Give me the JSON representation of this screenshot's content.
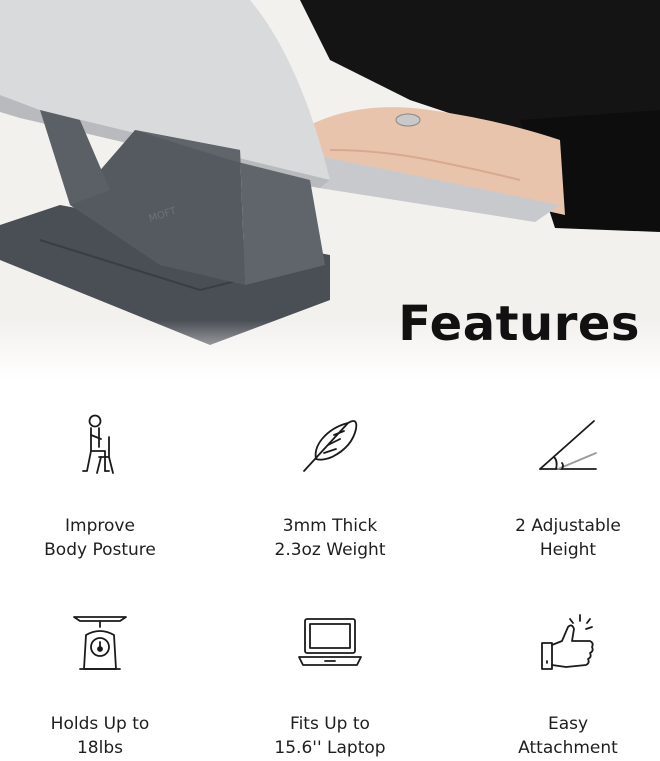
{
  "heading": "Features",
  "hero_brand_mark": "MOFT",
  "features": [
    {
      "icon": "sitting-person-icon",
      "line1": "Improve",
      "line2": "Body Posture"
    },
    {
      "icon": "feather-icon",
      "line1": "3mm Thick",
      "line2": "2.3oz Weight"
    },
    {
      "icon": "angle-icon",
      "line1": "2 Adjustable",
      "line2": "Height"
    },
    {
      "icon": "scale-icon",
      "line1": "Holds Up to",
      "line2": "18lbs"
    },
    {
      "icon": "laptop-icon",
      "line1": "Fits Up to",
      "line2": "15.6'' Laptop"
    },
    {
      "icon": "thumbs-up-icon",
      "line1": "Easy",
      "line2": "Attachment"
    }
  ]
}
